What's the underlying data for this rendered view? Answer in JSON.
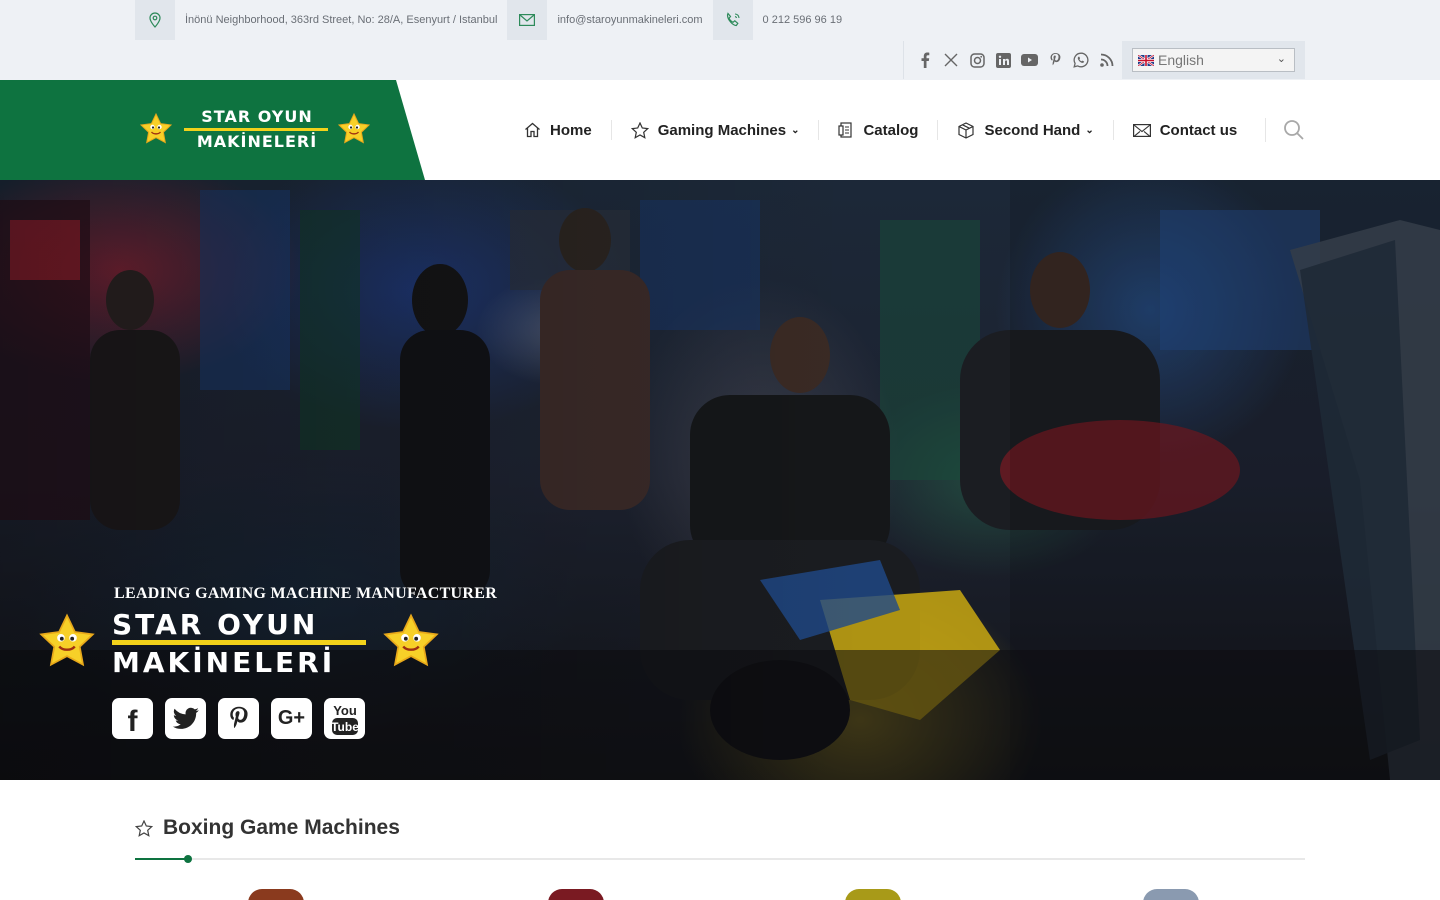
{
  "topbar": {
    "address": "İnönü Neighborhood, 363rd Street, No: 28/A, Esenyurt / Istanbul",
    "email": "info@staroyunmakineleri.com",
    "phone": "0 212 596 96 19",
    "social_icons": [
      "facebook-icon",
      "x-icon",
      "instagram-icon",
      "linkedin-icon",
      "youtube-icon",
      "pinterest-icon",
      "whatsapp-icon",
      "rss-icon"
    ],
    "language": "English"
  },
  "logo": {
    "line1": "STAR OYUN",
    "line2": "MAKİNELERİ"
  },
  "nav": {
    "home": "Home",
    "gaming_machines": "Gaming Machines",
    "catalog": "Catalog",
    "second_hand": "Second Hand",
    "contact": "Contact us"
  },
  "hero": {
    "tagline": "LEADING GAMING MACHINE MANUFACTURER",
    "logo_line1": "STAR OYUN",
    "logo_line2": "MAKİNELERİ",
    "social": [
      "facebook-icon",
      "twitter-icon",
      "pinterest-icon",
      "google-plus-icon",
      "youtube-icon"
    ]
  },
  "section": {
    "title": "Boxing Game Machines"
  },
  "colors": {
    "brand_green": "#0e7340",
    "logo_yellow": "#f2d21b",
    "topbar_bg": "#eef1f5"
  }
}
